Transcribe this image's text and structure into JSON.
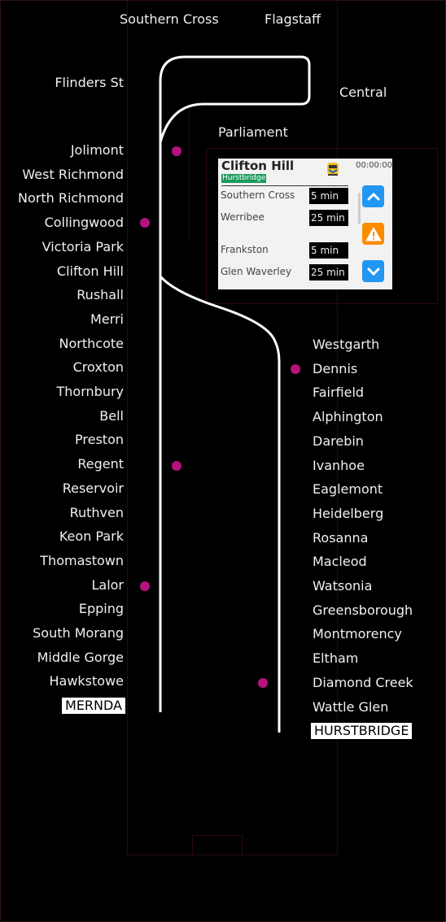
{
  "top_stations": {
    "southern_cross": "Southern Cross",
    "flagstaff": "Flagstaff",
    "flinders_st": "Flinders St",
    "central": "Central",
    "parliament": "Parliament"
  },
  "mernda_line": {
    "stations": [
      "Jolimont",
      "West Richmond",
      "North Richmond",
      "Collingwood",
      "Victoria Park",
      "Clifton Hill",
      "Rushall",
      "Merri",
      "Northcote",
      "Croxton",
      "Thornbury",
      "Bell",
      "Preston",
      "Regent",
      "Reservoir",
      "Ruthven",
      "Keon Park",
      "Thomastown",
      "Lalor",
      "Epping",
      "South Morang",
      "Middle Gorge",
      "Hawkstowe"
    ],
    "terminus": "MERNDA"
  },
  "hurstbridge_line": {
    "stations": [
      "Westgarth",
      "Dennis",
      "Fairfield",
      "Alphington",
      "Darebin",
      "Ivanhoe",
      "Eaglemont",
      "Heidelberg",
      "Rosanna",
      "Macleod",
      "Watsonia",
      "Greensborough",
      "Montmorency",
      "Eltham",
      "Diamond Creek",
      "Wattle Glen"
    ],
    "terminus": "HURSTBRIDGE"
  },
  "train_markers": {
    "color": "#b5127e",
    "near": [
      "Jolimont",
      "Collingwood",
      "Regent",
      "Lalor",
      "Dennis",
      "Diamond Creek"
    ]
  },
  "panel": {
    "station": "Clifton Hill",
    "line": "Hurstbridge",
    "line_color": "#1a9a5a",
    "time": "00:00:00",
    "train_icon": "train-icon",
    "departures": [
      {
        "destination": "Southern Cross",
        "eta": "5 min"
      },
      {
        "destination": "Werribee",
        "eta": "25 min"
      },
      {
        "destination": "Frankston",
        "eta": "5 min"
      },
      {
        "destination": "Glen Waverley",
        "eta": "25 min"
      }
    ],
    "buttons": {
      "up": "chevron-up-icon",
      "alert": "warning-icon",
      "down": "chevron-down-icon"
    }
  }
}
